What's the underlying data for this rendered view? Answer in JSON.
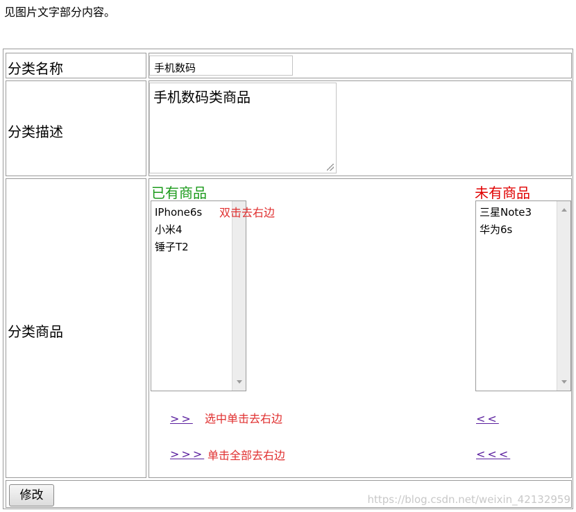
{
  "intro_text": "见图片文字部分内容。",
  "form": {
    "name_label": "分类名称",
    "name_value": "手机数码",
    "desc_label": "分类描述",
    "desc_value": "手机数码类商品",
    "products_label": "分类商品"
  },
  "has_products": {
    "title": "已有商品",
    "title_color": "#1b9a1b",
    "items": [
      "IPhone6s",
      "小米4",
      "锤子T2"
    ],
    "hint": "双击去右边"
  },
  "no_products": {
    "title": "未有商品",
    "title_color": "#e00000",
    "items": [
      "三星Note3",
      "华为6s"
    ]
  },
  "actions": {
    "move_selected_right": ">>",
    "move_selected_right_hint": "选中单击去右边",
    "move_all_right": ">>>",
    "move_all_right_hint": "单击全部去右边",
    "move_selected_left": "<<",
    "move_all_left": "<<<"
  },
  "submit_label": "修改",
  "watermark": "https://blog.csdn.net/weixin_42132959"
}
